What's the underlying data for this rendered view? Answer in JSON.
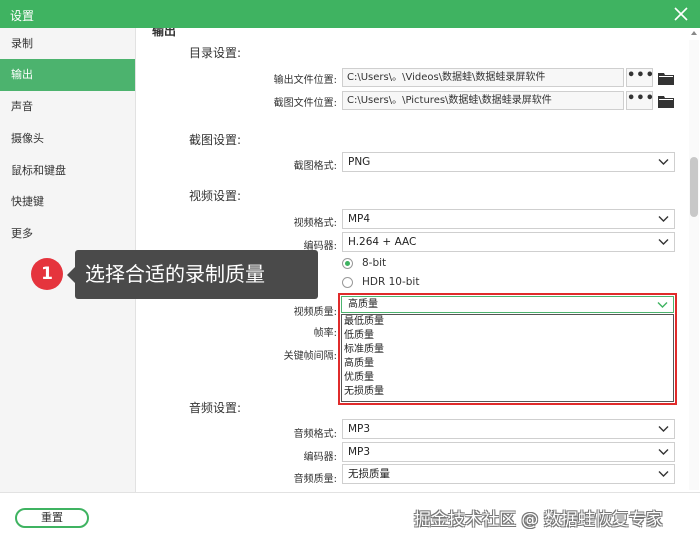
{
  "window": {
    "title": "设置"
  },
  "sidebar": {
    "items": [
      {
        "label": "录制",
        "active": false
      },
      {
        "label": "输出",
        "active": true
      },
      {
        "label": "声音",
        "active": false
      },
      {
        "label": "摄像头",
        "active": false
      },
      {
        "label": "鼠标和键盘",
        "active": false
      },
      {
        "label": "快捷键",
        "active": false
      },
      {
        "label": "更多",
        "active": false
      }
    ]
  },
  "main": {
    "section_title": "输出",
    "directory": {
      "title": "目录设置:",
      "output_label": "输出文件位置:",
      "output_value": "C:\\Users\\。\\Videos\\数据蛙\\数据蛙录屏软件",
      "screenshot_label": "截图文件位置:",
      "screenshot_value": "C:\\Users\\。\\Pictures\\数据蛙\\数据蛙录屏软件",
      "browse_label": "•••"
    },
    "screenshot": {
      "title": "截图设置:",
      "format_label": "截图格式:",
      "format_value": "PNG"
    },
    "video": {
      "title": "视频设置:",
      "format_label": "视频格式:",
      "format_value": "MP4",
      "encoder_label": "编码器:",
      "encoder_value": "H.264 + AAC",
      "bit_8": "8-bit",
      "bit_10": "HDR 10-bit",
      "quality_label": "视频质量:",
      "quality_value": "高质量",
      "quality_options": [
        "最低质量",
        "低质量",
        "标准质量",
        "高质量",
        "优质量",
        "无损质量"
      ],
      "fps_label": "帧率:",
      "keyframe_label": "关键帧间隔:"
    },
    "audio": {
      "title": "音频设置:",
      "format_label": "音频格式:",
      "format_value": "MP3",
      "encoder_label": "编码器:",
      "encoder_value": "MP3",
      "quality_label": "音频质量:",
      "quality_value": "无损质量"
    }
  },
  "tooltip": {
    "step": "1",
    "text": "选择合适的录制质量"
  },
  "footer": {
    "reset_label": "重置",
    "watermark": "掘金技术社区 @ 数据蛙恢复专家"
  },
  "colors": {
    "accent": "#3fb361",
    "highlight": "#e02b2b",
    "tip_bg": "#4a4a4a",
    "step_badge": "#e5343d"
  }
}
